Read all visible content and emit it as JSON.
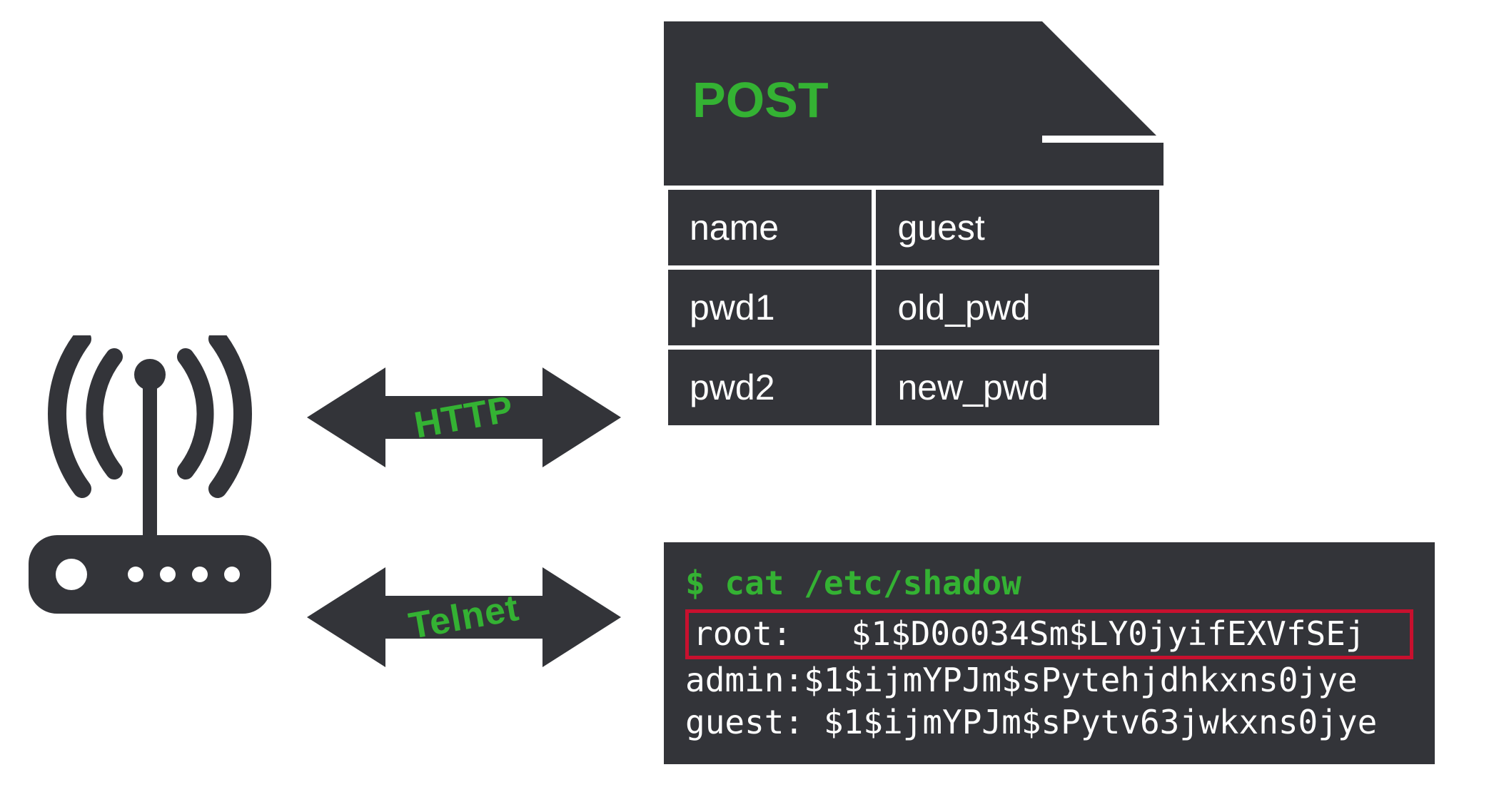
{
  "arrows": {
    "http": "HTTP",
    "telnet": "Telnet"
  },
  "post": {
    "method": "POST",
    "rows": [
      {
        "key": "name",
        "val": "guest"
      },
      {
        "key": "pwd1",
        "val": "old_pwd"
      },
      {
        "key": "pwd2",
        "val": "new_pwd"
      }
    ]
  },
  "terminal": {
    "command": "$ cat /etc/shadow",
    "root_line": "root:   $1$D0o034Sm$LY0jyifEXVfSEj",
    "admin_line": "admin:$1$ijmYPJm$sPytehjdhkxns0jye",
    "guest_line": "guest: $1$ijmYPJm$sPytv63jwkxns0jye"
  }
}
